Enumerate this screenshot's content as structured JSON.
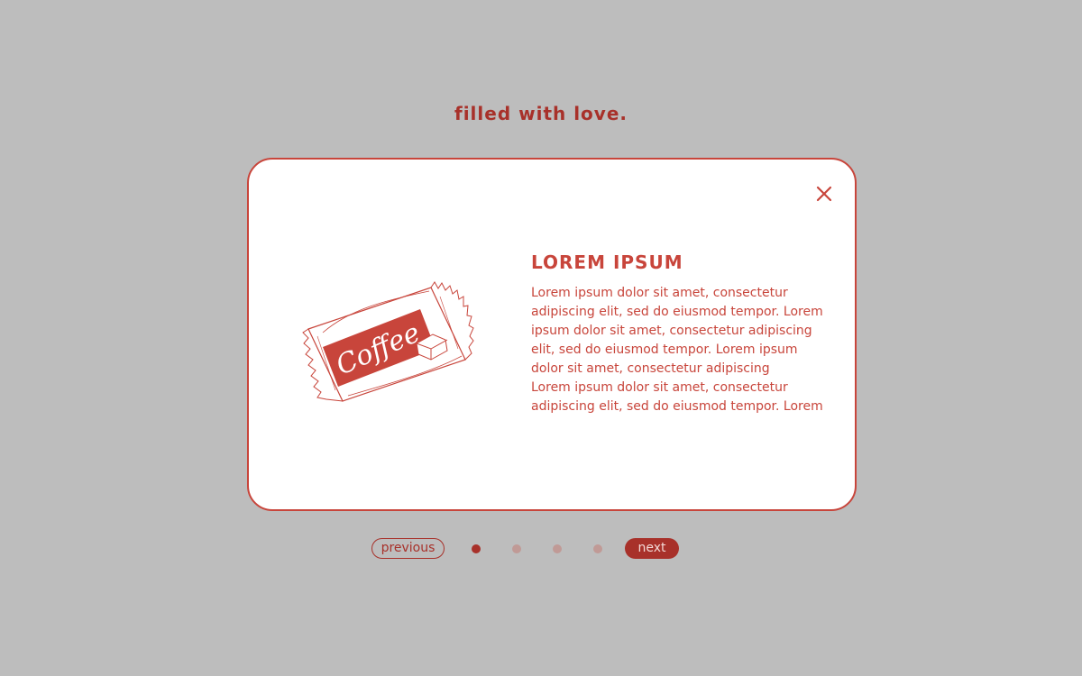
{
  "tagline": "filled with love.",
  "colors": {
    "accent": "#c8453b",
    "dark_accent": "#a8312a",
    "background": "#bdbdbd",
    "card": "#ffffff",
    "inactive_dot": "#c09a96"
  },
  "modal": {
    "close_icon": "close-icon",
    "illustration": {
      "icon": "coffee-candy-wrapper-illustration",
      "label": "Coffee"
    },
    "title": "LOREM IPSUM",
    "body_lines": [
      "Lorem ipsum dolor sit amet, consectetur",
      "adipiscing elit, sed do eiusmod tempor. Lorem",
      "ipsum dolor sit amet, consectetur adipiscing",
      "elit, sed do eiusmod tempor. Lorem ipsum",
      "dolor sit amet, consectetur adipiscing",
      "Lorem ipsum dolor sit amet, consectetur",
      "adipiscing elit, sed do eiusmod tempor. Lorem"
    ]
  },
  "pager": {
    "previous_label": "previous",
    "next_label": "next",
    "total_pages": 4,
    "current_page": 1
  }
}
